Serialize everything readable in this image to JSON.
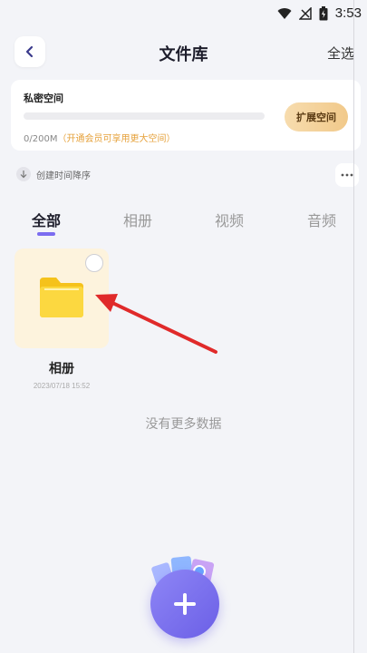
{
  "status_bar": {
    "time": "3:53",
    "icons": [
      "wifi-icon",
      "no-signal-icon",
      "battery-icon"
    ]
  },
  "header": {
    "title": "文件库",
    "select_all_label": "全选",
    "back_icon": "chevron-left-icon"
  },
  "storage": {
    "title": "私密空间",
    "used": "0",
    "total": "/200M",
    "promo": "（开通会员可享用更大空间）",
    "expand_label": "扩展空间",
    "used_fraction": 0
  },
  "sort": {
    "label": "创建时间降序",
    "icon": "arrow-down-icon",
    "more_icon": "more-horizontal-icon"
  },
  "tabs": [
    {
      "label": "全部",
      "active": true
    },
    {
      "label": "相册",
      "active": false
    },
    {
      "label": "视频",
      "active": false
    },
    {
      "label": "音频",
      "active": false
    }
  ],
  "files": [
    {
      "name": "相册",
      "date": "2023/07/18 15:52",
      "icon": "folder-icon"
    }
  ],
  "empty_note": "没有更多数据",
  "fab_icon": "plus-icon",
  "colors": {
    "accent": "#7b6cf0",
    "promo": "#e6a23c",
    "folder": "#fcd840",
    "arrow": "#e02a2a"
  }
}
